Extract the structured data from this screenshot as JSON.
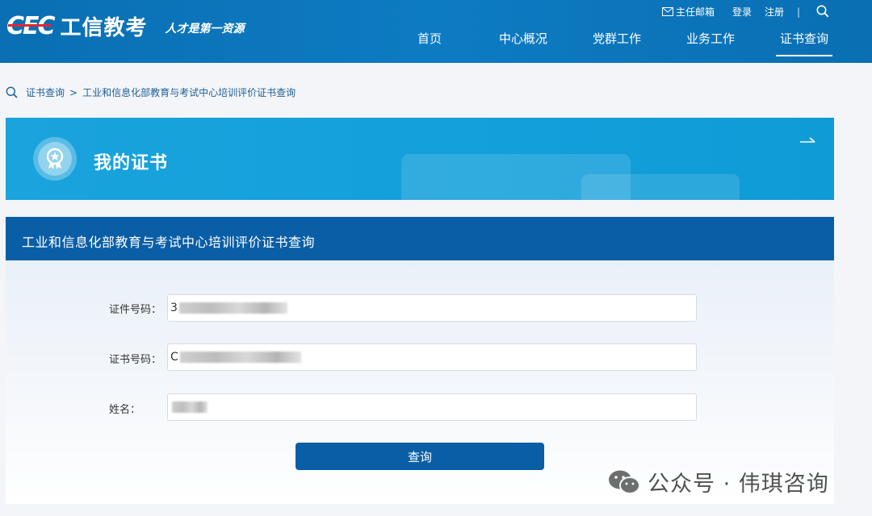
{
  "header": {
    "logo_mark": "CEC",
    "logo_name": "工信教考",
    "slogan": "人才是第一资源",
    "top_links": {
      "mail": "主任邮箱",
      "login": "登录",
      "register": "注册",
      "divider": "|"
    },
    "nav": [
      "首页",
      "中心概况",
      "党群工作",
      "业务工作",
      "证书查询"
    ],
    "active_nav": "证书查询",
    "colors": {
      "header_bg": "#0d7bc2",
      "accent_red": "#e0262d"
    }
  },
  "breadcrumb": {
    "root": "证书查询",
    "separator": ">",
    "current": "工业和信息化部教育与考试中心培训评价证书查询"
  },
  "banner": {
    "title": "我的证书",
    "icon": "certificate-badge-icon",
    "color": "#1aa3dc"
  },
  "form": {
    "title": "工业和信息化部教育与考试中心培训评价证书查询",
    "fields": [
      {
        "label": "证件号码：",
        "value_visible_prefix": "3"
      },
      {
        "label": "证书号码：",
        "value_visible_prefix": "C"
      },
      {
        "label": "姓名：",
        "value_visible_prefix": ""
      }
    ],
    "submit_label": "查询",
    "colors": {
      "header": "#0a5ea6",
      "button": "#0a5ea6"
    }
  },
  "watermark": {
    "text": "公众号 · 伟琪咨询",
    "icon": "wechat-icon"
  }
}
